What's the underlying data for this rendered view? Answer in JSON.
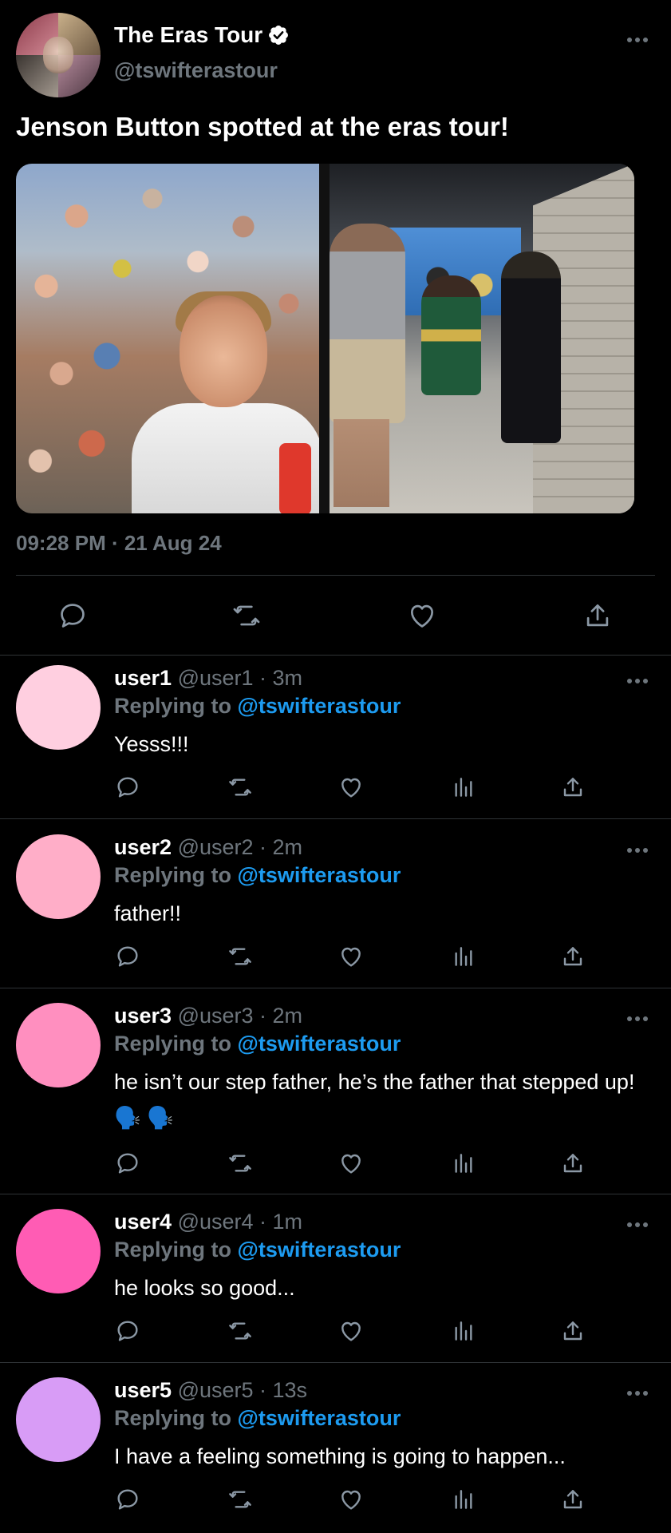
{
  "tweet": {
    "display_name": "The Eras Tour",
    "handle": "@tswifterastour",
    "text": "Jenson Button spotted at the eras tour!",
    "timestamp": "09:28 PM · 21 Aug 24",
    "verified": true,
    "media": [
      "photo-left",
      "photo-right"
    ],
    "actions": [
      "reply-icon",
      "retweet-icon",
      "like-icon",
      "share-icon"
    ]
  },
  "replies": [
    {
      "username": "user1",
      "meta": "@user1 · 3m",
      "replying_prefix": "Replying to",
      "replying_to": "@tswifterastour",
      "text": "Yesss!!!",
      "avatar_color": "#ffcfe0"
    },
    {
      "username": "user2",
      "meta": "@user2 · 2m",
      "replying_prefix": "Replying to",
      "replying_to": "@tswifterastour",
      "text": "father!!",
      "avatar_color": "#ffaec8"
    },
    {
      "username": "user3",
      "meta": "@user3 · 2m",
      "replying_prefix": "Replying to",
      "replying_to": "@tswifterastour",
      "text": "he isn’t our step father, he’s the father that stepped up!🗣️ 🗣️",
      "avatar_color": "#ff8fbf"
    },
    {
      "username": "user4",
      "meta": "@user4 · 1m",
      "replying_prefix": "Replying to",
      "replying_to": "@tswifterastour",
      "text": "he looks so good...",
      "avatar_color": "#ff5cb4"
    },
    {
      "username": "user5",
      "meta": "@user5 · 13s",
      "replying_prefix": "Replying to",
      "replying_to": "@tswifterastour",
      "text": "I have a feeling something is going to happen...",
      "avatar_color": "#d89cf6"
    }
  ],
  "colors": {
    "background": "#000000",
    "text": "#ffffff",
    "secondary": "#6e767d",
    "link": "#1d9bf0",
    "divider": "#2f3336"
  }
}
